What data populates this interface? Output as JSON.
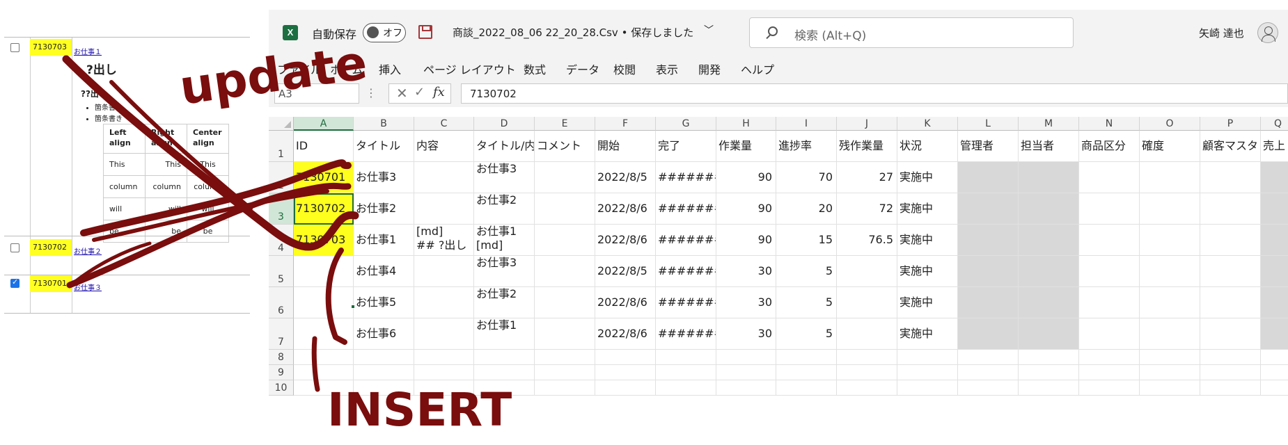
{
  "browser_panel": {
    "rows": [
      {
        "checked": false,
        "id": "7130703",
        "link": "お仕事１"
      },
      {
        "checked": false,
        "id": "7130702",
        "link": "お仕事２"
      },
      {
        "checked": true,
        "id": "7130701",
        "link": "お仕事３"
      }
    ],
    "heading1": "?出し",
    "heading2": "??出し",
    "bullets": [
      "箇条書き",
      "箇条書き"
    ],
    "table": {
      "headers": [
        "Left align",
        "Right align",
        "Center align"
      ],
      "rows": [
        [
          "This",
          "This",
          "This"
        ],
        [
          "column",
          "column",
          "column"
        ],
        [
          "will",
          "will",
          "will"
        ],
        [
          "be",
          "be",
          "be"
        ]
      ]
    }
  },
  "excel": {
    "app_icon": "X",
    "autosave_label": "自動保存",
    "autosave_state": "オフ",
    "filename": "商談_2022_08_06 22_20_28.Csv • 保存しました",
    "search_placeholder": "検索 (Alt+Q)",
    "user_name": "矢崎 達也",
    "menu": [
      "ファイル",
      "ホーム",
      "挿入",
      "ページ レイアウト",
      "数式",
      "データ",
      "校閲",
      "表示",
      "開発",
      "ヘルプ"
    ],
    "name_box": "A3",
    "formula_value": "7130702",
    "columns": [
      "A",
      "B",
      "C",
      "D",
      "E",
      "F",
      "G",
      "H",
      "I",
      "J",
      "K",
      "L",
      "M",
      "N",
      "O",
      "P",
      "Q"
    ],
    "row_numbers": [
      "1",
      "2",
      "3",
      "4",
      "5",
      "6",
      "7",
      "8",
      "9",
      "10"
    ],
    "header_row": [
      "ID",
      "タイトル",
      "内容",
      "タイトル/内容",
      "コメント",
      "開始",
      "完了",
      "作業量",
      "進捗率",
      "残作業量",
      "状況",
      "管理者",
      "担当者",
      "商品区分",
      "確度",
      "顧客マスタ",
      "売上"
    ],
    "data_rows": [
      [
        "7130701",
        "お仕事3",
        "",
        "お仕事3",
        "",
        "2022/8/5",
        "########",
        "90",
        "70",
        "27",
        "実施中"
      ],
      [
        "7130702",
        "お仕事2",
        "",
        "お仕事2",
        "",
        "2022/8/6",
        "########",
        "90",
        "20",
        "72",
        "実施中"
      ],
      [
        "7130703",
        "お仕事1",
        "[md]\n## ?出し",
        "お仕事1\n[md]",
        "",
        "2022/8/6",
        "########",
        "90",
        "15",
        "76.5",
        "実施中"
      ],
      [
        "",
        "お仕事4",
        "",
        "お仕事3",
        "",
        "2022/8/5",
        "########",
        "30",
        "5",
        "",
        "実施中"
      ],
      [
        "",
        "お仕事5",
        "",
        "お仕事2",
        "",
        "2022/8/6",
        "########",
        "30",
        "5",
        "",
        "実施中"
      ],
      [
        "",
        "お仕事6",
        "",
        "お仕事1",
        "",
        "2022/8/6",
        "########",
        "30",
        "5",
        "",
        "実施中"
      ]
    ]
  },
  "annotations": {
    "update": "update",
    "insert": "INSERT",
    "ink_color": "#7a0d0d"
  }
}
